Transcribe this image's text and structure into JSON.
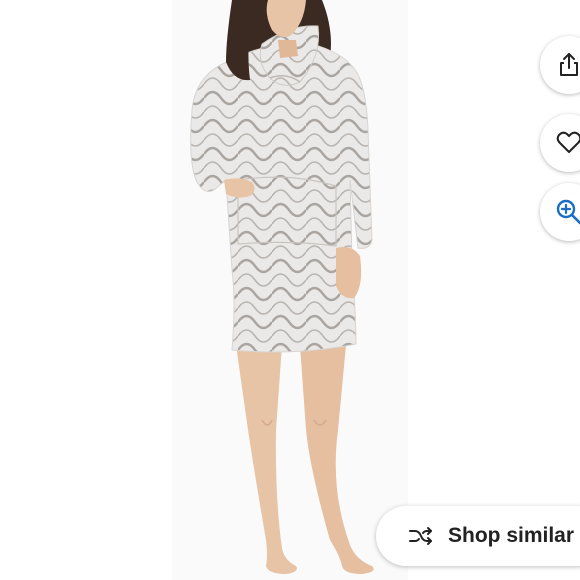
{
  "product_image": {
    "alt": "",
    "garment_color": "#e8e6e4",
    "pattern_color": "#a9a4a0"
  },
  "actions": {
    "share_icon": "share-icon",
    "like_icon": "heart-icon",
    "zoom_icon": "zoom-in-icon",
    "accent_color": "#1a6fc4"
  },
  "shop_similar": {
    "label": "Shop similar",
    "icon": "shuffle-icon"
  }
}
